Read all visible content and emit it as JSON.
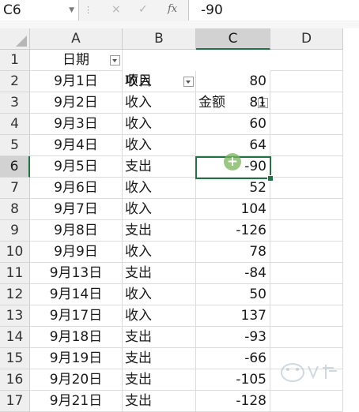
{
  "namebox": {
    "value": "C6"
  },
  "formula": {
    "value": "-90",
    "fx_label": "fx",
    "cancel_icon": "×",
    "enter_icon": "✓"
  },
  "columns": [
    "A",
    "B",
    "C",
    "D"
  ],
  "selected_column": "C",
  "selected_row": "6",
  "header_row": {
    "row": "1",
    "A": "日期",
    "B": "项目",
    "C": "金额"
  },
  "rows": [
    {
      "row": "2",
      "date": "9月1日",
      "item": "收入",
      "amount": "80"
    },
    {
      "row": "3",
      "date": "9月2日",
      "item": "收入",
      "amount": "81"
    },
    {
      "row": "4",
      "date": "9月3日",
      "item": "收入",
      "amount": "60"
    },
    {
      "row": "5",
      "date": "9月4日",
      "item": "收入",
      "amount": "64"
    },
    {
      "row": "6",
      "date": "9月5日",
      "item": "支出",
      "amount": "-90"
    },
    {
      "row": "7",
      "date": "9月6日",
      "item": "收入",
      "amount": "52"
    },
    {
      "row": "8",
      "date": "9月7日",
      "item": "收入",
      "amount": "104"
    },
    {
      "row": "9",
      "date": "9月8日",
      "item": "支出",
      "amount": "-126"
    },
    {
      "row": "10",
      "date": "9月9日",
      "item": "收入",
      "amount": "78"
    },
    {
      "row": "11",
      "date": "9月13日",
      "item": "支出",
      "amount": "-84"
    },
    {
      "row": "12",
      "date": "9月14日",
      "item": "收入",
      "amount": "50"
    },
    {
      "row": "13",
      "date": "9月17日",
      "item": "收入",
      "amount": "137"
    },
    {
      "row": "14",
      "date": "9月18日",
      "item": "支出",
      "amount": "-93"
    },
    {
      "row": "15",
      "date": "9月19日",
      "item": "支出",
      "amount": "-66"
    },
    {
      "row": "16",
      "date": "9月20日",
      "item": "支出",
      "amount": "-105"
    },
    {
      "row": "17",
      "date": "9月21日",
      "item": "支出",
      "amount": "-128"
    }
  ],
  "colors": {
    "accent": "#217346",
    "header_bg": "#efefef",
    "selected_header_bg": "#d2d2d2"
  },
  "cursor_icon": "plus-cursor-icon"
}
